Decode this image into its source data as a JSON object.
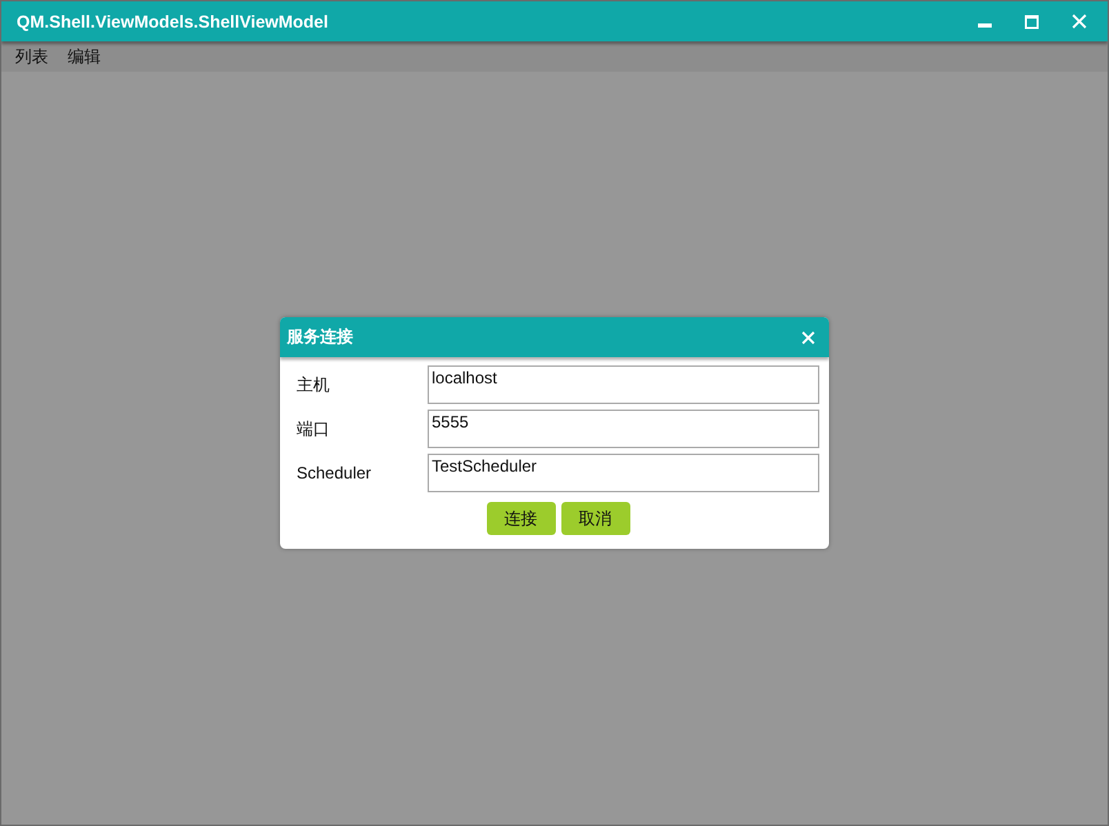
{
  "window": {
    "title": "QM.Shell.ViewModels.ShellViewModel"
  },
  "menu": {
    "items": [
      "列表",
      "编辑"
    ]
  },
  "dialog": {
    "title": "服务连接",
    "fields": [
      {
        "label": "主机",
        "value": "localhost"
      },
      {
        "label": "端口",
        "value": "5555"
      },
      {
        "label": "Scheduler",
        "value": "TestScheduler"
      }
    ],
    "buttons": [
      "连接",
      "取消"
    ]
  }
}
